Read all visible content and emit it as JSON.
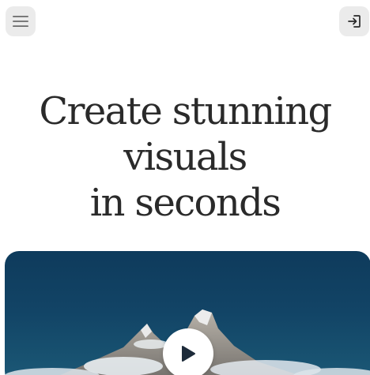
{
  "header": {
    "menu_icon": "hamburger-menu-icon",
    "login_icon": "sign-in-icon"
  },
  "hero": {
    "title_lines": [
      "Create stunning",
      "visuals",
      "in seconds"
    ]
  },
  "media": {
    "description_icon": "play-icon",
    "accent_color": "#124466"
  }
}
